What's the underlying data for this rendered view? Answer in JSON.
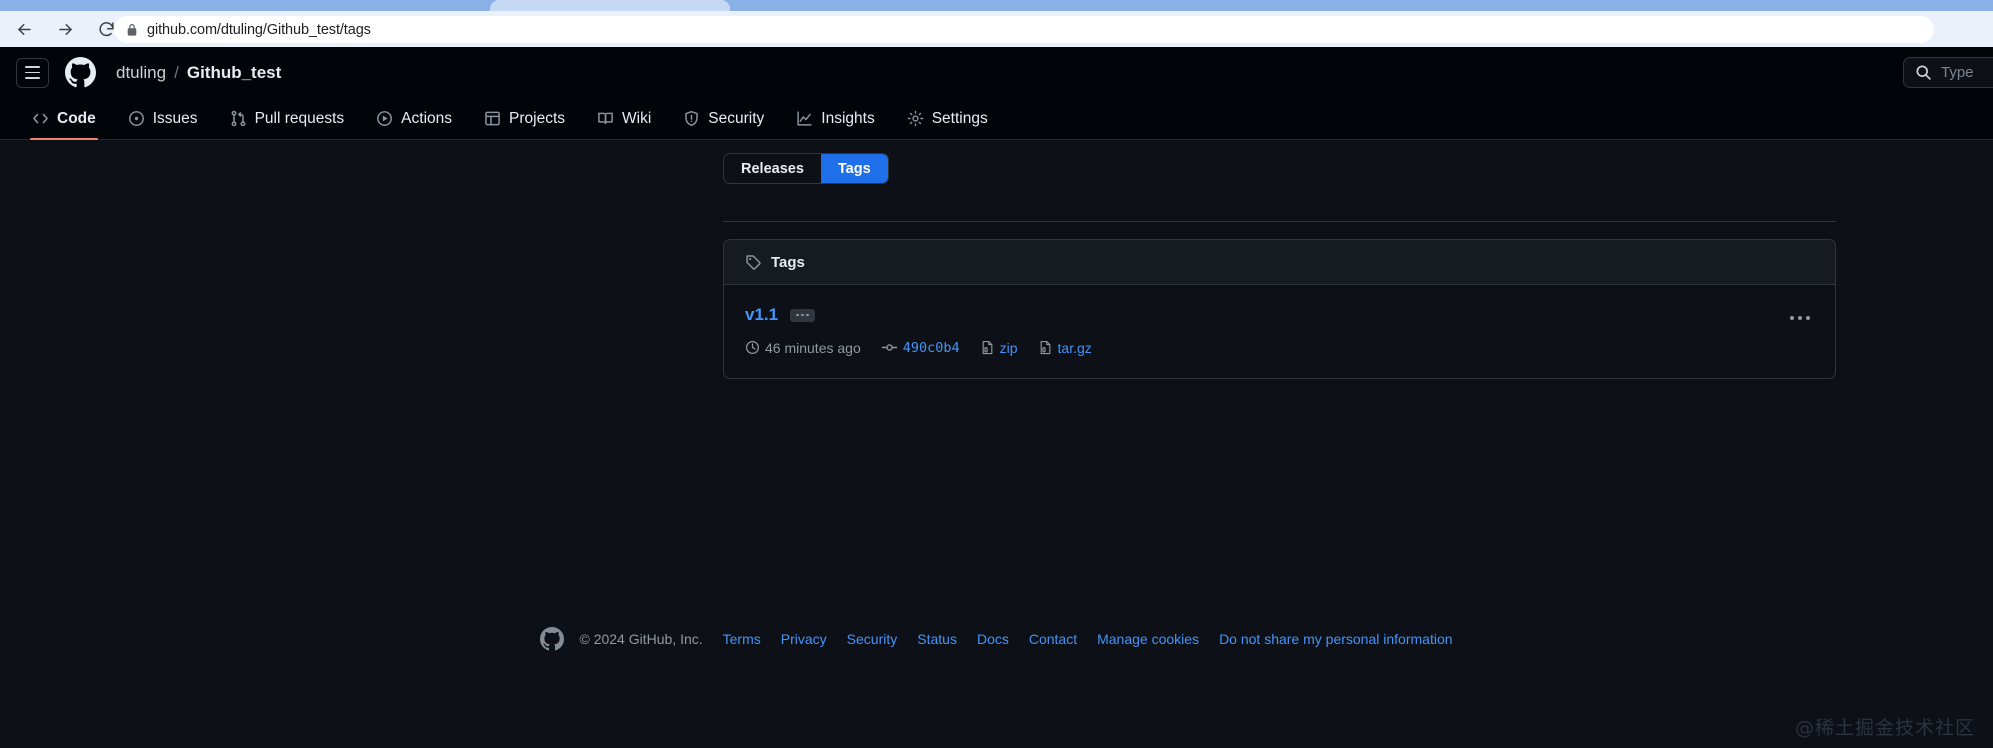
{
  "browser": {
    "back_icon": "arrow-left-icon",
    "forward_icon": "arrow-right-icon",
    "reload_icon": "reload-icon",
    "lock_icon": "lock-icon",
    "url_host": "github.com",
    "url_path": "/dtuling/Github_test/tags",
    "url_full": "github.com/dtuling/Github_test/tags"
  },
  "header": {
    "menu_icon": "hamburger-icon",
    "logo_icon": "github-mark-icon",
    "owner": "dtuling",
    "separator": "/",
    "repo": "Github_test",
    "search_icon": "search-icon",
    "search_placeholder": "Type"
  },
  "nav": {
    "items": [
      {
        "label": "Code",
        "icon": "code-icon",
        "selected": true
      },
      {
        "label": "Issues",
        "icon": "issue-opened-icon",
        "selected": false
      },
      {
        "label": "Pull requests",
        "icon": "git-pull-request-icon",
        "selected": false
      },
      {
        "label": "Actions",
        "icon": "play-icon",
        "selected": false
      },
      {
        "label": "Projects",
        "icon": "table-icon",
        "selected": false
      },
      {
        "label": "Wiki",
        "icon": "book-icon",
        "selected": false
      },
      {
        "label": "Security",
        "icon": "shield-icon",
        "selected": false
      },
      {
        "label": "Insights",
        "icon": "graph-icon",
        "selected": false
      },
      {
        "label": "Settings",
        "icon": "gear-icon",
        "selected": false
      }
    ],
    "accent_underline": "#f78166"
  },
  "toggle": {
    "releases_label": "Releases",
    "tags_label": "Tags",
    "active": "Tags",
    "active_color": "#1f6feb"
  },
  "tags_panel": {
    "icon": "tag-icon",
    "title": "Tags",
    "rows": [
      {
        "name": "v1.1",
        "expander_icon": "ellipsis-badge-icon",
        "time_icon": "clock-icon",
        "time": "46 minutes ago",
        "commit_icon": "git-commit-icon",
        "commit": "490c0b4",
        "zip_icon": "file-zip-icon",
        "zip_label": "zip",
        "targz_icon": "file-zip-icon",
        "targz_label": "tar.gz",
        "kebab_icon": "kebab-horizontal-icon"
      }
    ]
  },
  "footer": {
    "logo_icon": "github-mark-icon",
    "copyright": "© 2024 GitHub, Inc.",
    "links": [
      "Terms",
      "Privacy",
      "Security",
      "Status",
      "Docs",
      "Contact",
      "Manage cookies",
      "Do not share my personal information"
    ]
  },
  "watermark": "@稀土掘金技术社区"
}
